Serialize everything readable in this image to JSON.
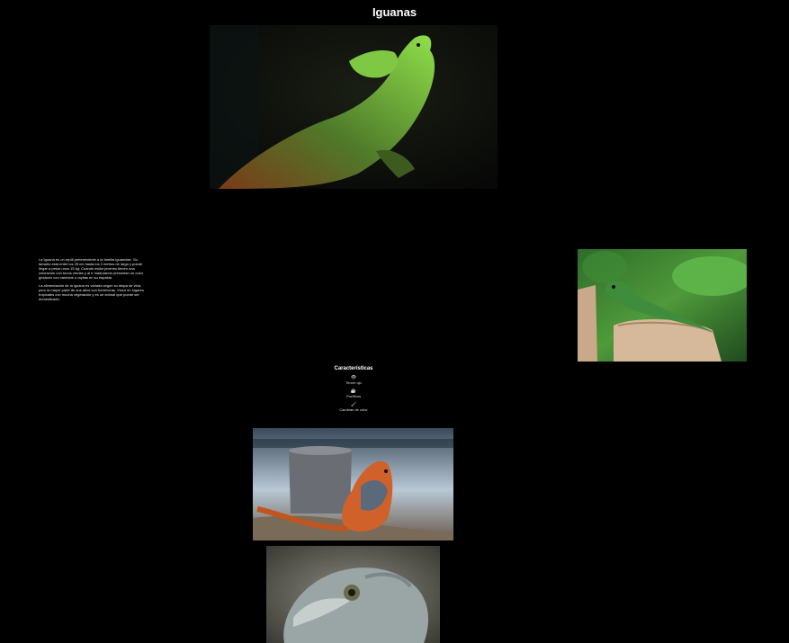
{
  "page": {
    "title": "Iguanas"
  },
  "intro": {
    "paragraph_1": "La Iguana es un reptil perteneciente a la familia Iguanidae. Su tamaño está entre los 25 cm hasta los 2 metros de largo y puede llegar a pesar unos 15 kg. Cuando están jóvenes tienen una coloración con tonos verdes y al ir madurando presentan un color grisáceo con cambios o rayitas en su espalda.",
    "paragraph_2": "La alimentación de la iguana es variada según su etapa de vida, pero la mayor parte de sus años son herbívoras. Viven en lugares tropicales con mucha vegetación y es un animal que puede ser domesticado."
  },
  "features": {
    "heading": "Características",
    "items": [
      {
        "icon": "eye-icon",
        "glyph": "👁",
        "label": "Tercer ojo"
      },
      {
        "icon": "mug-icon",
        "glyph": "☕",
        "label": "Pacíficos"
      },
      {
        "icon": "brush-icon",
        "glyph": "🖌",
        "label": "Cambian de color"
      }
    ]
  },
  "images": {
    "hero": "green-iguana-dark-background",
    "side": "green-lizard-on-stump",
    "beach": "orange-iguana-on-beach",
    "face": "iguana-face-closeup"
  },
  "colors": {
    "background": "#000000",
    "text": "#ffffff"
  }
}
